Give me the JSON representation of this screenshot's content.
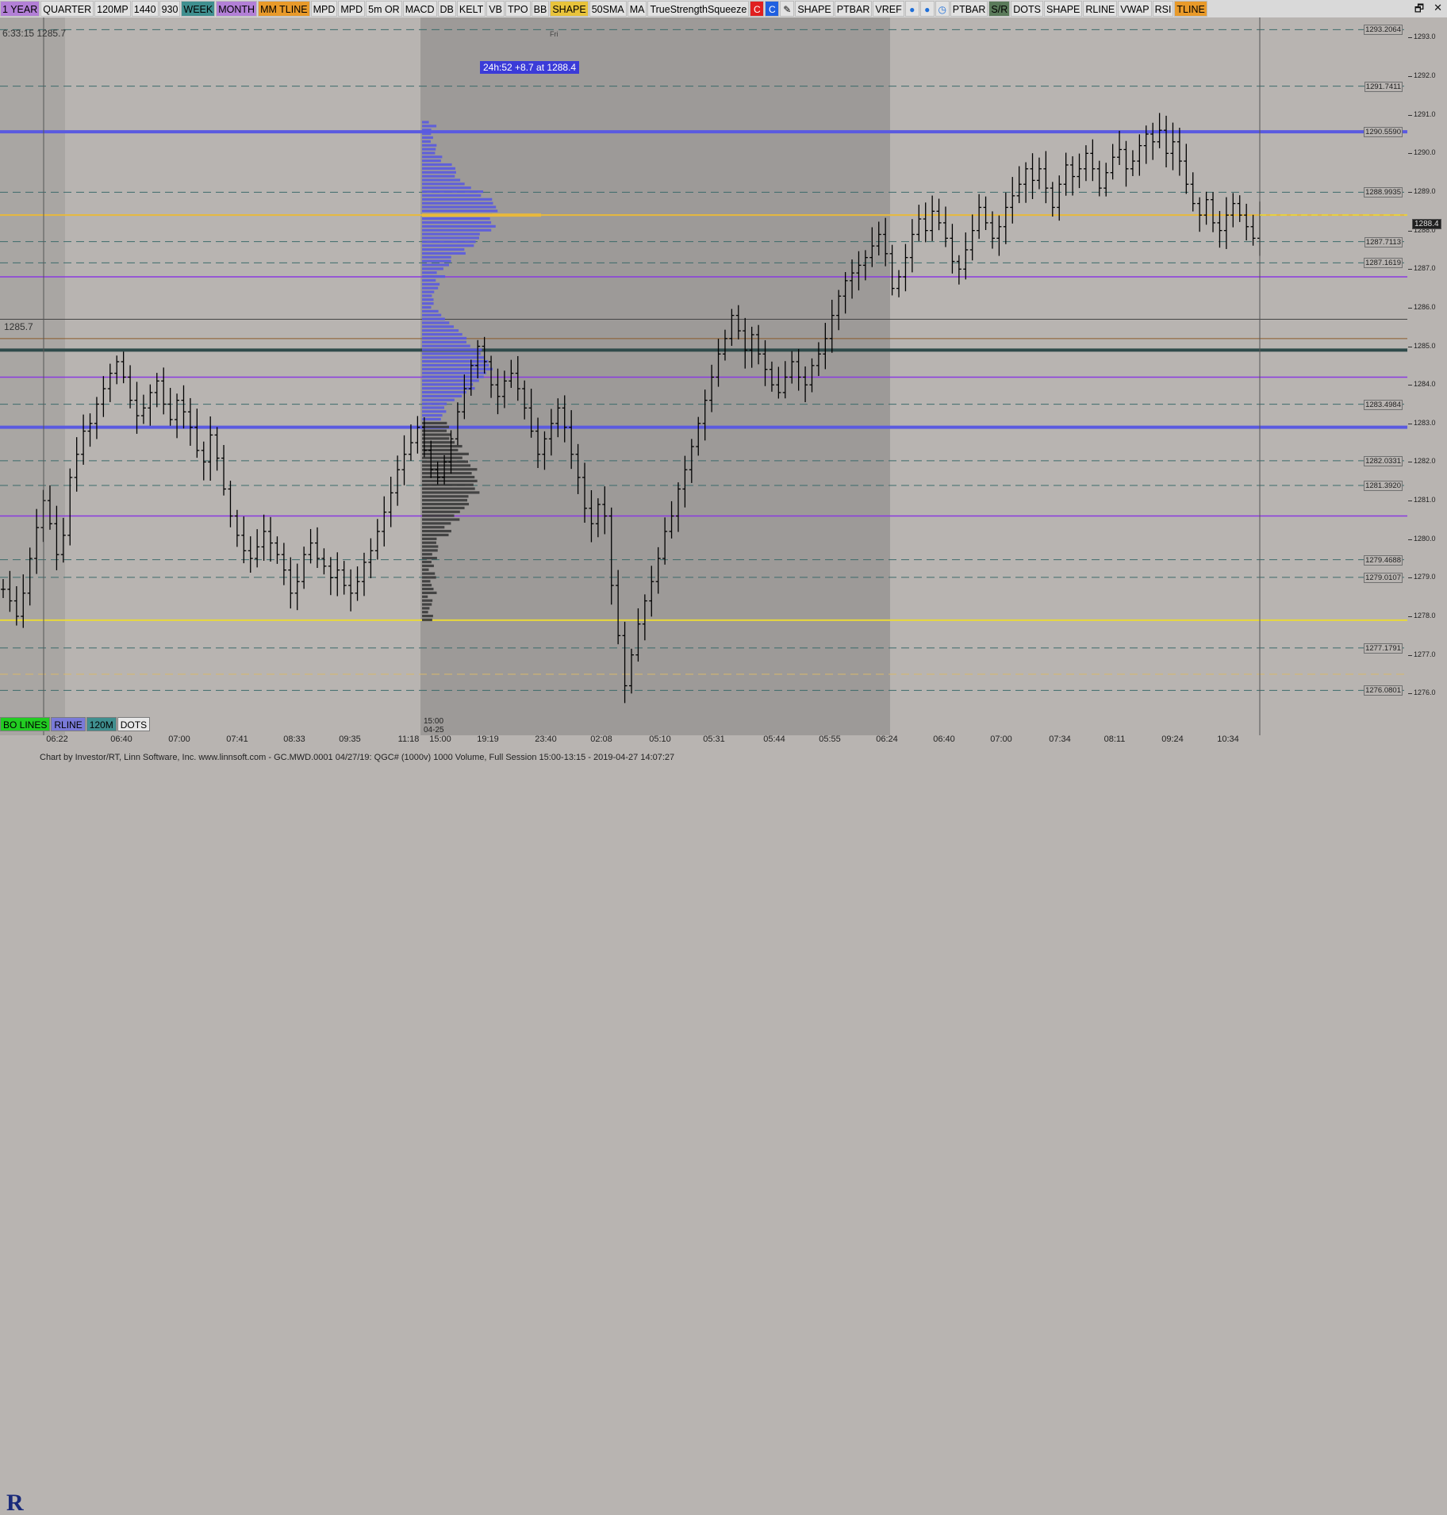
{
  "toolbar": {
    "buttons": [
      {
        "label": "1 YEAR",
        "bg": "#b27fd6"
      },
      {
        "label": "QUARTER",
        "bg": "#e2e2e2"
      },
      {
        "label": "120MP",
        "bg": "#e2e2e2"
      },
      {
        "label": "1440",
        "bg": "#e2e2e2"
      },
      {
        "label": "930",
        "bg": "#e2e2e2"
      },
      {
        "label": "WEEK",
        "bg": "#3f8f8f"
      },
      {
        "label": "MONTH",
        "bg": "#b27fd6"
      },
      {
        "label": "MM TLINE",
        "bg": "#e89a2a"
      },
      {
        "label": "MPD",
        "bg": "#e2e2e2"
      },
      {
        "label": "MPD",
        "bg": "#e2e2e2"
      },
      {
        "label": "5m OR",
        "bg": "#e2e2e2"
      },
      {
        "label": "MACD",
        "bg": "#e2e2e2"
      },
      {
        "label": "DB",
        "bg": "#e2e2e2"
      },
      {
        "label": "KELT",
        "bg": "#e2e2e2"
      },
      {
        "label": "VB",
        "bg": "#e2e2e2"
      },
      {
        "label": "TPO",
        "bg": "#e2e2e2"
      },
      {
        "label": "BB",
        "bg": "#e2e2e2"
      },
      {
        "label": "SHAPE",
        "bg": "#e8c33b"
      },
      {
        "label": "50SMA",
        "bg": "#e2e2e2"
      },
      {
        "label": "MA",
        "bg": "#e2e2e2"
      },
      {
        "label": "TrueStrengthSqueeze",
        "bg": "#e2e2e2"
      }
    ],
    "icon_buttons": [
      {
        "icon": "red-square-icon",
        "glyph": "C",
        "bg": "#e02020"
      },
      {
        "icon": "blue-square-icon",
        "glyph": "C",
        "bg": "#2060e0"
      },
      {
        "icon": "pencil-icon",
        "glyph": "✎",
        "bg": "#e2e2e2"
      }
    ],
    "buttons2": [
      {
        "label": "SHAPE",
        "bg": "#e2e2e2"
      },
      {
        "label": "PTBAR",
        "bg": "#e2e2e2"
      },
      {
        "label": "VREF",
        "bg": "#e2e2e2"
      }
    ],
    "icon_buttons2": [
      {
        "icon": "flame-icon",
        "glyph": "●",
        "bg": "#e2e2e2"
      },
      {
        "icon": "flame-icon",
        "glyph": "●",
        "bg": "#e2e2e2"
      },
      {
        "icon": "clock-icon",
        "glyph": "◷",
        "bg": "#e2e2e2"
      }
    ],
    "buttons3": [
      {
        "label": "PTBAR",
        "bg": "#e2e2e2"
      },
      {
        "label": "S/R",
        "bg": "#5a7a5a"
      },
      {
        "label": "DOTS",
        "bg": "#e2e2e2"
      },
      {
        "label": "SHAPE",
        "bg": "#e2e2e2"
      },
      {
        "label": "RLINE",
        "bg": "#e2e2e2"
      },
      {
        "label": "VWAP",
        "bg": "#e2e2e2"
      },
      {
        "label": "RSI",
        "bg": "#e2e2e2"
      },
      {
        "label": "TLINE",
        "bg": "#e89a2a"
      }
    ]
  },
  "window_controls": {
    "restore": "🗗",
    "close": "✕"
  },
  "bottom_buttons": [
    {
      "label": "BO LINES",
      "bg": "#22cc22"
    },
    {
      "label": "RLINE",
      "bg": "#7a7ad8"
    },
    {
      "label": "120M",
      "bg": "#3f8f8f"
    },
    {
      "label": "DOTS",
      "bg": "#e8e8e8"
    }
  ],
  "overlay": {
    "topleft_time": "6:33:15  1285.7",
    "left_price": "1285.7",
    "fr_label": "Fri",
    "info_box": "24h:52  +8.7 at 1288.4",
    "current_price": "1288.4",
    "session_start_label": "15:00",
    "session_start_date": "04-25"
  },
  "axis": {
    "ticks": [
      "1293.0",
      "1292.0",
      "1291.0",
      "1290.0",
      "1289.0",
      "1288.0",
      "1287.0",
      "1286.0",
      "1285.0",
      "1284.0",
      "1283.0",
      "1282.0",
      "1281.0",
      "1280.0",
      "1279.0",
      "1278.0",
      "1277.0",
      "1276.0"
    ],
    "labels": [
      "1293.2064",
      "1291.7411",
      "1290.5590",
      "1288.9935",
      "1287.7113",
      "1287.1619",
      "1283.4984",
      "1282.0331",
      "1281.3920",
      "1279.4688",
      "1279.0107",
      "1277.1791",
      "1276.0801"
    ]
  },
  "time_axis": [
    "06:22",
    "06:40",
    "07:00",
    "07:41",
    "08:33",
    "09:35",
    "11:18",
    "15:00",
    "19:19",
    "23:40",
    "02:08",
    "05:10",
    "05:31",
    "05:44",
    "05:55",
    "06:24",
    "06:40",
    "07:00",
    "07:34",
    "08:11",
    "09:24",
    "10:34"
  ],
  "footer": {
    "text": "Chart by Investor/RT, Linn Software, Inc. www.linnsoft.com - GC.MWD.0001   04/27/19: QGC# (1000v) 1000 Volume, Full Session 15:00-13:15 - 2019-04-27 14:07:27"
  },
  "chart_data": {
    "type": "bar",
    "ylim": [
      1275.8,
      1293.4
    ],
    "level_lines": [
      {
        "price": 1293.2064,
        "color": "#3c6b6b",
        "style": "dash"
      },
      {
        "price": 1291.7411,
        "color": "#3c6b6b",
        "style": "dash"
      },
      {
        "price": 1290.559,
        "color": "#5a5ae0",
        "style": "solid",
        "width": 4
      },
      {
        "price": 1288.9935,
        "color": "#3c6b6b",
        "style": "dash"
      },
      {
        "price": 1288.4,
        "color": "#e8b93b",
        "style": "solid",
        "width": 2
      },
      {
        "price": 1287.7113,
        "color": "#3c6b6b",
        "style": "dash"
      },
      {
        "price": 1287.1619,
        "color": "#3c6b6b",
        "style": "dash"
      },
      {
        "price": 1286.8,
        "color": "#8a3ae0",
        "style": "solid",
        "width": 1.5
      },
      {
        "price": 1285.7,
        "color": "#444",
        "style": "solid",
        "width": 1
      },
      {
        "price": 1285.2,
        "color": "#8a5a2a",
        "style": "solid",
        "width": 1
      },
      {
        "price": 1284.9,
        "color": "#2f4a4a",
        "style": "solid",
        "width": 4
      },
      {
        "price": 1284.2,
        "color": "#8a3ae0",
        "style": "solid",
        "width": 1.5
      },
      {
        "price": 1283.4984,
        "color": "#3c6b6b",
        "style": "dash"
      },
      {
        "price": 1282.9,
        "color": "#5a5ae0",
        "style": "solid",
        "width": 4
      },
      {
        "price": 1282.0331,
        "color": "#3c6b6b",
        "style": "dash"
      },
      {
        "price": 1281.392,
        "color": "#3c6b6b",
        "style": "dash"
      },
      {
        "price": 1280.6,
        "color": "#8a3ae0",
        "style": "solid",
        "width": 1.5
      },
      {
        "price": 1279.4688,
        "color": "#3c6b6b",
        "style": "dash"
      },
      {
        "price": 1279.0107,
        "color": "#3c6b6b",
        "style": "dash"
      },
      {
        "price": 1277.9,
        "color": "#e8d83b",
        "style": "solid",
        "width": 2
      },
      {
        "price": 1277.1791,
        "color": "#3c6b6b",
        "style": "dash"
      },
      {
        "price": 1276.5,
        "color": "#d8b86b",
        "style": "dash"
      },
      {
        "price": 1276.0801,
        "color": "#3c6b6b",
        "style": "dash"
      }
    ],
    "closes": [
      1278.7,
      1278.4,
      1278.0,
      1278.6,
      1279.5,
      1280.3,
      1281.0,
      1280.4,
      1279.6,
      1280.1,
      1281.6,
      1282.2,
      1282.8,
      1283.0,
      1283.5,
      1283.9,
      1284.3,
      1284.6,
      1284.2,
      1283.6,
      1283.2,
      1283.4,
      1283.8,
      1284.1,
      1283.5,
      1283.1,
      1283.6,
      1283.3,
      1282.9,
      1282.3,
      1282.0,
      1282.7,
      1282.1,
      1281.3,
      1280.6,
      1280.1,
      1279.7,
      1279.5,
      1279.8,
      1280.2,
      1279.9,
      1279.6,
      1279.2,
      1278.6,
      1278.9,
      1279.6,
      1279.9,
      1279.5,
      1279.3,
      1279.0,
      1279.2,
      1278.8,
      1278.6,
      1278.9,
      1279.4,
      1279.7,
      1280.2,
      1280.7,
      1281.2,
      1281.8,
      1282.2,
      1282.5,
      1282.9,
      1282.3,
      1281.8,
      1281.6,
      1282.0,
      1282.6,
      1283.3,
      1283.9,
      1284.5,
      1285.0,
      1284.6,
      1284.0,
      1283.7,
      1284.1,
      1284.3,
      1283.9,
      1283.4,
      1282.8,
      1282.2,
      1282.6,
      1283.0,
      1283.4,
      1282.9,
      1282.2,
      1281.6,
      1280.8,
      1280.4,
      1280.9,
      1280.6,
      1278.8,
      1277.5,
      1276.2,
      1277.0,
      1277.8,
      1278.4,
      1278.9,
      1279.5,
      1280.2,
      1280.6,
      1281.3,
      1281.8,
      1282.4,
      1283.0,
      1283.6,
      1284.2,
      1284.8,
      1285.2,
      1285.8,
      1285.4,
      1284.9,
      1285.3,
      1284.8,
      1284.4,
      1284.0,
      1283.8,
      1284.2,
      1284.6,
      1284.2,
      1284.0,
      1284.5,
      1284.8,
      1285.2,
      1285.8,
      1286.3,
      1286.7,
      1286.9,
      1287.1,
      1287.3,
      1287.6,
      1287.9,
      1287.4,
      1286.5,
      1286.8,
      1287.3,
      1287.9,
      1288.3,
      1288.0,
      1288.5,
      1288.2,
      1287.8,
      1287.2,
      1287.0,
      1287.5,
      1288.0,
      1288.6,
      1288.2,
      1287.8,
      1288.1,
      1288.6,
      1288.9,
      1289.2,
      1289.6,
      1289.3,
      1289.6,
      1289.1,
      1288.6,
      1289.2,
      1289.7,
      1289.4,
      1289.6,
      1290.0,
      1289.6,
      1289.1,
      1289.5,
      1289.9,
      1290.1,
      1289.6,
      1289.8,
      1290.2,
      1290.5,
      1290.3,
      1290.6,
      1290.0,
      1290.3,
      1289.8,
      1289.2,
      1288.7,
      1288.4,
      1288.8,
      1288.2,
      1288.0,
      1288.4,
      1288.7,
      1288.4,
      1288.1,
      1287.8,
      1288.4
    ]
  }
}
